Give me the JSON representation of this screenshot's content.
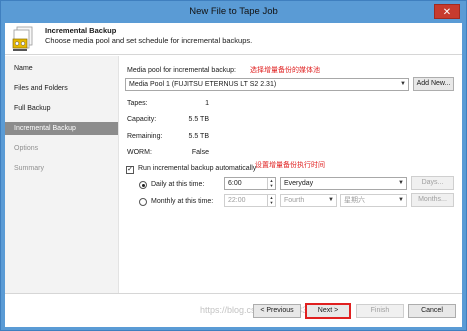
{
  "window": {
    "title": "New File to Tape Job",
    "close_glyph": "✕"
  },
  "header": {
    "title": "Incremental Backup",
    "subtitle": "Choose media pool and set schedule for incremental backups."
  },
  "sidebar": {
    "items": [
      {
        "label": "Name",
        "state": "normal"
      },
      {
        "label": "Files and Folders",
        "state": "normal"
      },
      {
        "label": "Full Backup",
        "state": "normal"
      },
      {
        "label": "Incremental Backup",
        "state": "active"
      },
      {
        "label": "Options",
        "state": "disabled"
      },
      {
        "label": "Summary",
        "state": "disabled"
      }
    ]
  },
  "main": {
    "media_pool_label": "Media pool for incremental backup:",
    "annotation_media": "选择增量备份的媒体池",
    "media_pool_value": "Media Pool 1 (FUJITSU ETERNUS LT S2 2.31)",
    "add_new_label": "Add New...",
    "stats": [
      {
        "label": "Tapes:",
        "value": "1"
      },
      {
        "label": "Capacity:",
        "value": "5.5 TB"
      },
      {
        "label": "Remaining:",
        "value": "5.5 TB"
      },
      {
        "label": "WORM:",
        "value": "False"
      }
    ],
    "run_auto_label": "Run incremental backup automatically",
    "run_auto_checked": "✓",
    "annotation_schedule": "设置增量备份执行时间",
    "daily_label": "Daily at this time:",
    "daily_time": "6:00",
    "daily_period": "Everyday",
    "days_label": "Days...",
    "monthly_label": "Monthly at this time:",
    "monthly_time": "22:00",
    "monthly_week": "Fourth",
    "monthly_day": "星期六",
    "months_label": "Months..."
  },
  "footer": {
    "previous_label": "< Previous",
    "next_label": "Next >",
    "finish_label": "Finish",
    "cancel_label": "Cancel",
    "watermark": "https://blog.csdn.net/ztj3333630"
  },
  "colors": {
    "accent": "#5a9bd5",
    "annotation": "#e02020",
    "active_sidebar": "#8c8c8c"
  },
  "icons": {
    "header": "tape-job-icon",
    "close": "close-icon",
    "dropdown": "chevron-down-icon"
  }
}
